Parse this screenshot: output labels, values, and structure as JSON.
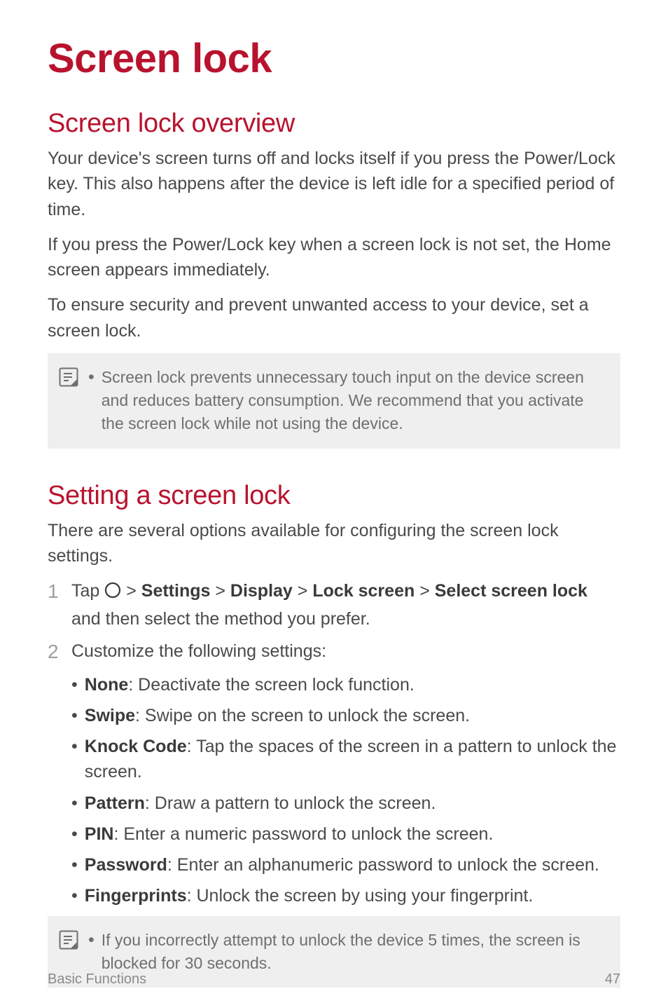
{
  "title": "Screen lock",
  "overview": {
    "heading": "Screen lock overview",
    "p1": "Your device's screen turns off and locks itself if you press the Power/Lock key. This also happens after the device is left idle for a specified period of time.",
    "p2": "If you press the Power/Lock key when a screen lock is not set, the Home screen appears immediately.",
    "p3": "To ensure security and prevent unwanted access to your device, set a screen lock.",
    "note": "Screen lock prevents unnecessary touch input on the device screen and reduces battery consumption. We recommend that you activate the screen lock while not using the device."
  },
  "setting": {
    "heading": "Setting a screen lock",
    "intro": "There are several options available for configuring the screen lock settings.",
    "step1": {
      "num": "1",
      "prefix": "Tap ",
      "path_parts": [
        "Settings",
        "Display",
        "Lock screen",
        "Select screen lock"
      ],
      "suffix": " and then select the method you prefer."
    },
    "step2": {
      "num": "2",
      "text": "Customize the following settings:",
      "options": [
        {
          "name": "None",
          "desc": ": Deactivate the screen lock function."
        },
        {
          "name": "Swipe",
          "desc": ": Swipe on the screen to unlock the screen."
        },
        {
          "name": "Knock Code",
          "desc": ": Tap the spaces of the screen in a pattern to unlock the screen."
        },
        {
          "name": "Pattern",
          "desc": ": Draw a pattern to unlock the screen."
        },
        {
          "name": "PIN",
          "desc": ": Enter a numeric password to unlock the screen."
        },
        {
          "name": "Password",
          "desc": ": Enter an alphanumeric password to unlock the screen."
        },
        {
          "name": "Fingerprints",
          "desc": ": Unlock the screen by using your fingerprint."
        }
      ]
    },
    "note2": "If you incorrectly attempt to unlock the device 5 times, the screen is blocked for 30 seconds."
  },
  "footer": {
    "section": "Basic Functions",
    "page": "47"
  }
}
